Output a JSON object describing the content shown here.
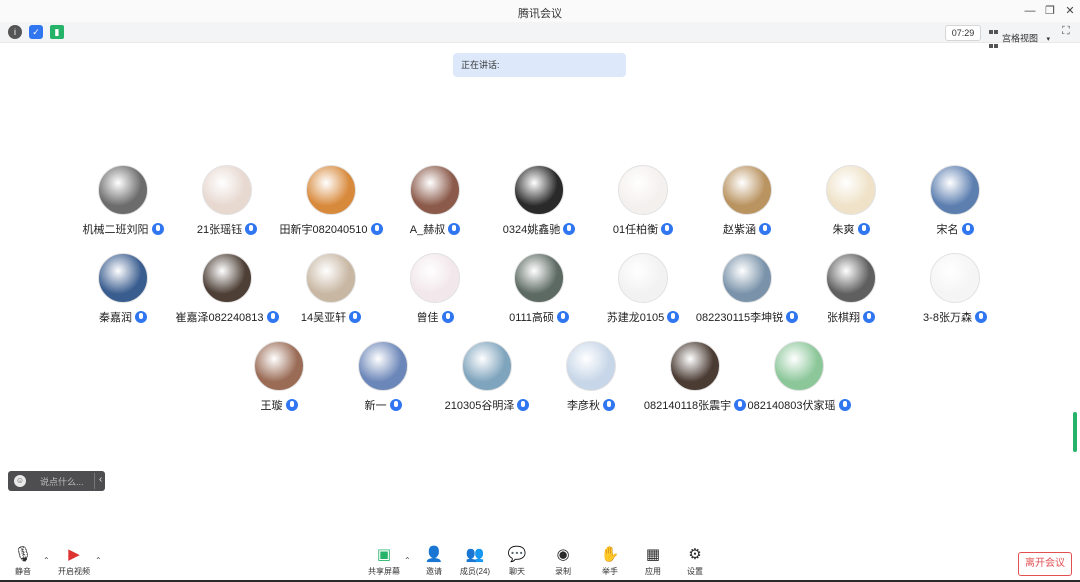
{
  "window": {
    "title": "腾讯会议"
  },
  "infobar": {
    "timer": "07:29",
    "view_mode": "宫格视图"
  },
  "speaking": {
    "label": "正在讲话:"
  },
  "participants": [
    {
      "name": "机械二班刘阳",
      "color": "#6c6c6c"
    },
    {
      "name": "21张瑶钰",
      "color": "#e7d8d0"
    },
    {
      "name": "田新宇082040510",
      "color": "#d88a3c"
    },
    {
      "name": "A_赫叔",
      "color": "#8b5a4a"
    },
    {
      "name": "0324姚鑫驰",
      "color": "#2a2a2a"
    },
    {
      "name": "01任柏衡",
      "color": "#f4f0ee"
    },
    {
      "name": "赵紫涵",
      "color": "#b99360"
    },
    {
      "name": "朱爽",
      "color": "#efe2c8"
    },
    {
      "name": "宋名",
      "color": "#5d7fb0"
    },
    {
      "name": "秦嘉润",
      "color": "#3a5d8f"
    },
    {
      "name": "崔嘉泽082240813",
      "color": "#4d3f36"
    },
    {
      "name": "14吴亚轩",
      "color": "#c8b7a3"
    },
    {
      "name": "曾佳",
      "color": "#f2e7ea"
    },
    {
      "name": "0111高硕",
      "color": "#5d6a63"
    },
    {
      "name": "苏建龙0105",
      "color": "#f2f2f2"
    },
    {
      "name": "082230115李坤锐",
      "color": "#7a93aa"
    },
    {
      "name": "张棋翔",
      "color": "#5f5f5f"
    },
    {
      "name": "3-8张万森",
      "color": "#f5f5f5"
    },
    {
      "name": "王璇",
      "color": "#9a6b55"
    },
    {
      "name": "新一",
      "color": "#6b86b8"
    },
    {
      "name": "210305谷明泽",
      "color": "#7fa4bd"
    },
    {
      "name": "李彦秋",
      "color": "#c7d6e8"
    },
    {
      "name": "082140118张震宇",
      "color": "#4a3b33"
    },
    {
      "name": "082140803伏家瑶",
      "color": "#8cc79a"
    }
  ],
  "chat": {
    "placeholder": "说点什么..."
  },
  "toolbar": {
    "mute": "静音",
    "video": "开启视频",
    "share": "共享屏幕",
    "invite": "邀请",
    "members": "成员(24)",
    "chat": "聊天",
    "record": "录制",
    "raise_hand": "举手",
    "apps": "应用",
    "settings": "设置",
    "leave": "离开会议"
  },
  "colors": {
    "accent": "#2f76f0",
    "leave": "#e25151",
    "scroll": "#25b369"
  }
}
